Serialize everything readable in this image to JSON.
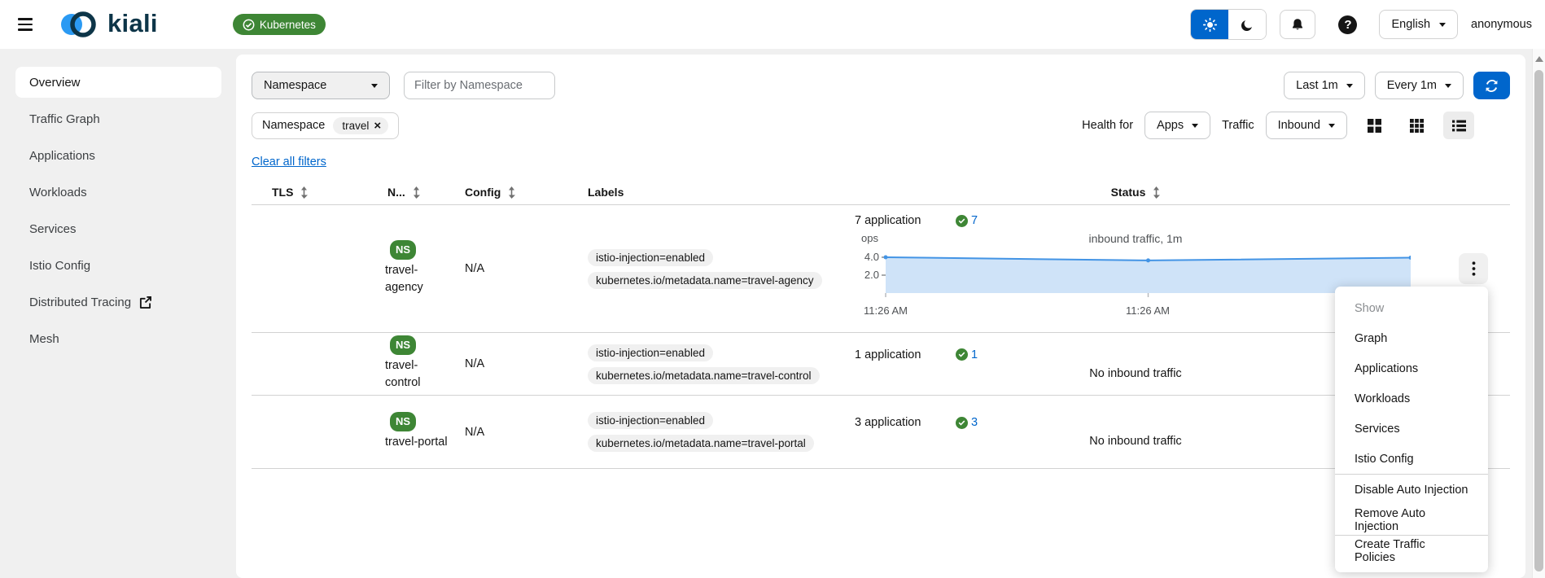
{
  "masthead": {
    "brand": "kiali",
    "cluster_badge": "Kubernetes",
    "language": "English",
    "user": "anonymous"
  },
  "sidebar": {
    "items": [
      {
        "label": "Overview",
        "active": true
      },
      {
        "label": "Traffic Graph"
      },
      {
        "label": "Applications"
      },
      {
        "label": "Workloads"
      },
      {
        "label": "Services"
      },
      {
        "label": "Istio Config"
      },
      {
        "label": "Distributed Tracing",
        "external": true
      },
      {
        "label": "Mesh"
      }
    ]
  },
  "toolbar": {
    "filter_type": "Namespace",
    "filter_placeholder": "Filter by Namespace",
    "duration": "Last 1m",
    "refresh": "Every 1m",
    "active_filter_category": "Namespace",
    "active_filter_value": "travel",
    "clear_all": "Clear all filters",
    "health_for_label": "Health for",
    "health_for": "Apps",
    "traffic_label": "Traffic",
    "traffic_direction": "Inbound"
  },
  "table": {
    "headers": [
      {
        "label": "TLS",
        "sortable": true
      },
      {
        "label": "N...",
        "sortable": true
      },
      {
        "label": "Config",
        "sortable": true
      },
      {
        "label": "Labels",
        "sortable": false
      },
      {
        "label": "Status",
        "sortable": true
      }
    ],
    "rows": [
      {
        "badge": "NS",
        "name": "travel-agency",
        "config": "N/A",
        "labels": [
          "istio-injection=enabled",
          "kubernetes.io/metadata.name=travel-agency"
        ],
        "apps_label": "7 application",
        "health_count": "7",
        "chart": {
          "type": "line",
          "title": "inbound traffic, 1m",
          "unit": "ops",
          "yticks": [
            "4.0",
            "2.0"
          ],
          "xticks": [
            "11:26 AM",
            "11:26 AM"
          ],
          "values": [
            4.0,
            3.65,
            3.95
          ],
          "ymax": 5.0
        }
      },
      {
        "badge": "NS",
        "name": "travel-control",
        "config": "N/A",
        "labels": [
          "istio-injection=enabled",
          "kubernetes.io/metadata.name=travel-control"
        ],
        "apps_label": "1 application",
        "health_count": "1",
        "status_text": "No inbound traffic"
      },
      {
        "badge": "NS",
        "name": "travel-portal",
        "config": "N/A",
        "labels": [
          "istio-injection=enabled",
          "kubernetes.io/metadata.name=travel-portal"
        ],
        "apps_label": "3 application",
        "health_count": "3",
        "status_text": "No inbound traffic"
      }
    ]
  },
  "context_menu": {
    "items": [
      {
        "label": "Show",
        "disabled": true
      },
      {
        "label": "Graph"
      },
      {
        "label": "Applications"
      },
      {
        "label": "Workloads"
      },
      {
        "label": "Services"
      },
      {
        "label": "Istio Config",
        "divider_after": true
      },
      {
        "label": "Disable Auto Injection"
      },
      {
        "label": "Remove Auto Injection",
        "divider_after": true
      },
      {
        "label": "Create Traffic Policies"
      }
    ]
  },
  "colors": {
    "primary": "#0066cc",
    "success_green": "#3e8635",
    "link_blue": "#0066cc",
    "chart_line": "#4394e5",
    "chart_fill": "#cfe3f8",
    "brand_navy": "#0d3548",
    "brand_blue": "#2b9af3"
  }
}
